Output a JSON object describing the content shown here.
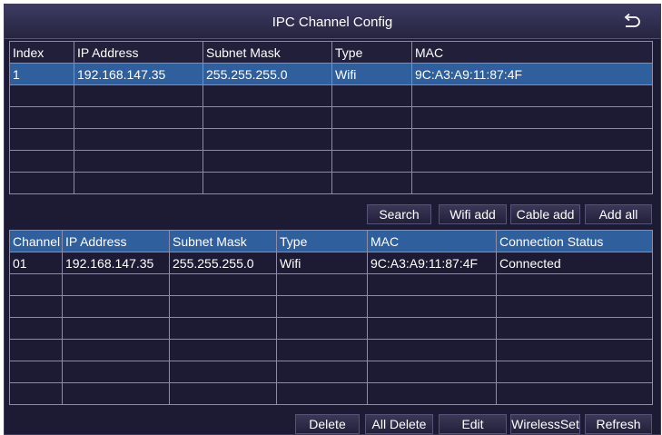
{
  "window": {
    "title": "IPC Channel Config"
  },
  "search_table": {
    "columns": [
      "Index",
      "IP Address",
      "Subnet Mask",
      "Type",
      "MAC"
    ],
    "rows": [
      [
        "1",
        "192.168.147.35",
        "255.255.255.0",
        "Wifi",
        "9C:A3:A9:11:87:4F"
      ],
      [
        "",
        "",
        "",
        "",
        ""
      ],
      [
        "",
        "",
        "",
        "",
        ""
      ],
      [
        "",
        "",
        "",
        "",
        ""
      ],
      [
        "",
        "",
        "",
        "",
        ""
      ],
      [
        "",
        "",
        "",
        "",
        ""
      ]
    ],
    "selected_row": 0
  },
  "search_buttons": {
    "search": "Search",
    "wifi_add": "Wifi add",
    "cable_add": "Cable add",
    "add_all": "Add all"
  },
  "channel_table": {
    "columns": [
      "Channel",
      "IP Address",
      "Subnet Mask",
      "Type",
      "MAC",
      "Connection Status"
    ],
    "rows": [
      [
        "01",
        "192.168.147.35",
        "255.255.255.0",
        "Wifi",
        "9C:A3:A9:11:87:4F",
        "Connected"
      ],
      [
        "",
        "",
        "",
        "",
        "",
        ""
      ],
      [
        "",
        "",
        "",
        "",
        "",
        ""
      ],
      [
        "",
        "",
        "",
        "",
        "",
        ""
      ],
      [
        "",
        "",
        "",
        "",
        "",
        ""
      ],
      [
        "",
        "",
        "",
        "",
        "",
        ""
      ],
      [
        "",
        "",
        "",
        "",
        "",
        ""
      ]
    ]
  },
  "channel_buttons": {
    "delete": "Delete",
    "all_delete": "All Delete",
    "edit": "Edit",
    "wireless_set": "WirelessSet",
    "refresh": "Refresh"
  },
  "icons": {
    "back": "back-arrow-icon"
  },
  "colors": {
    "background": "#1d1b33",
    "selected": "#2f5f9c",
    "grid_line": "#8d8ba8"
  }
}
